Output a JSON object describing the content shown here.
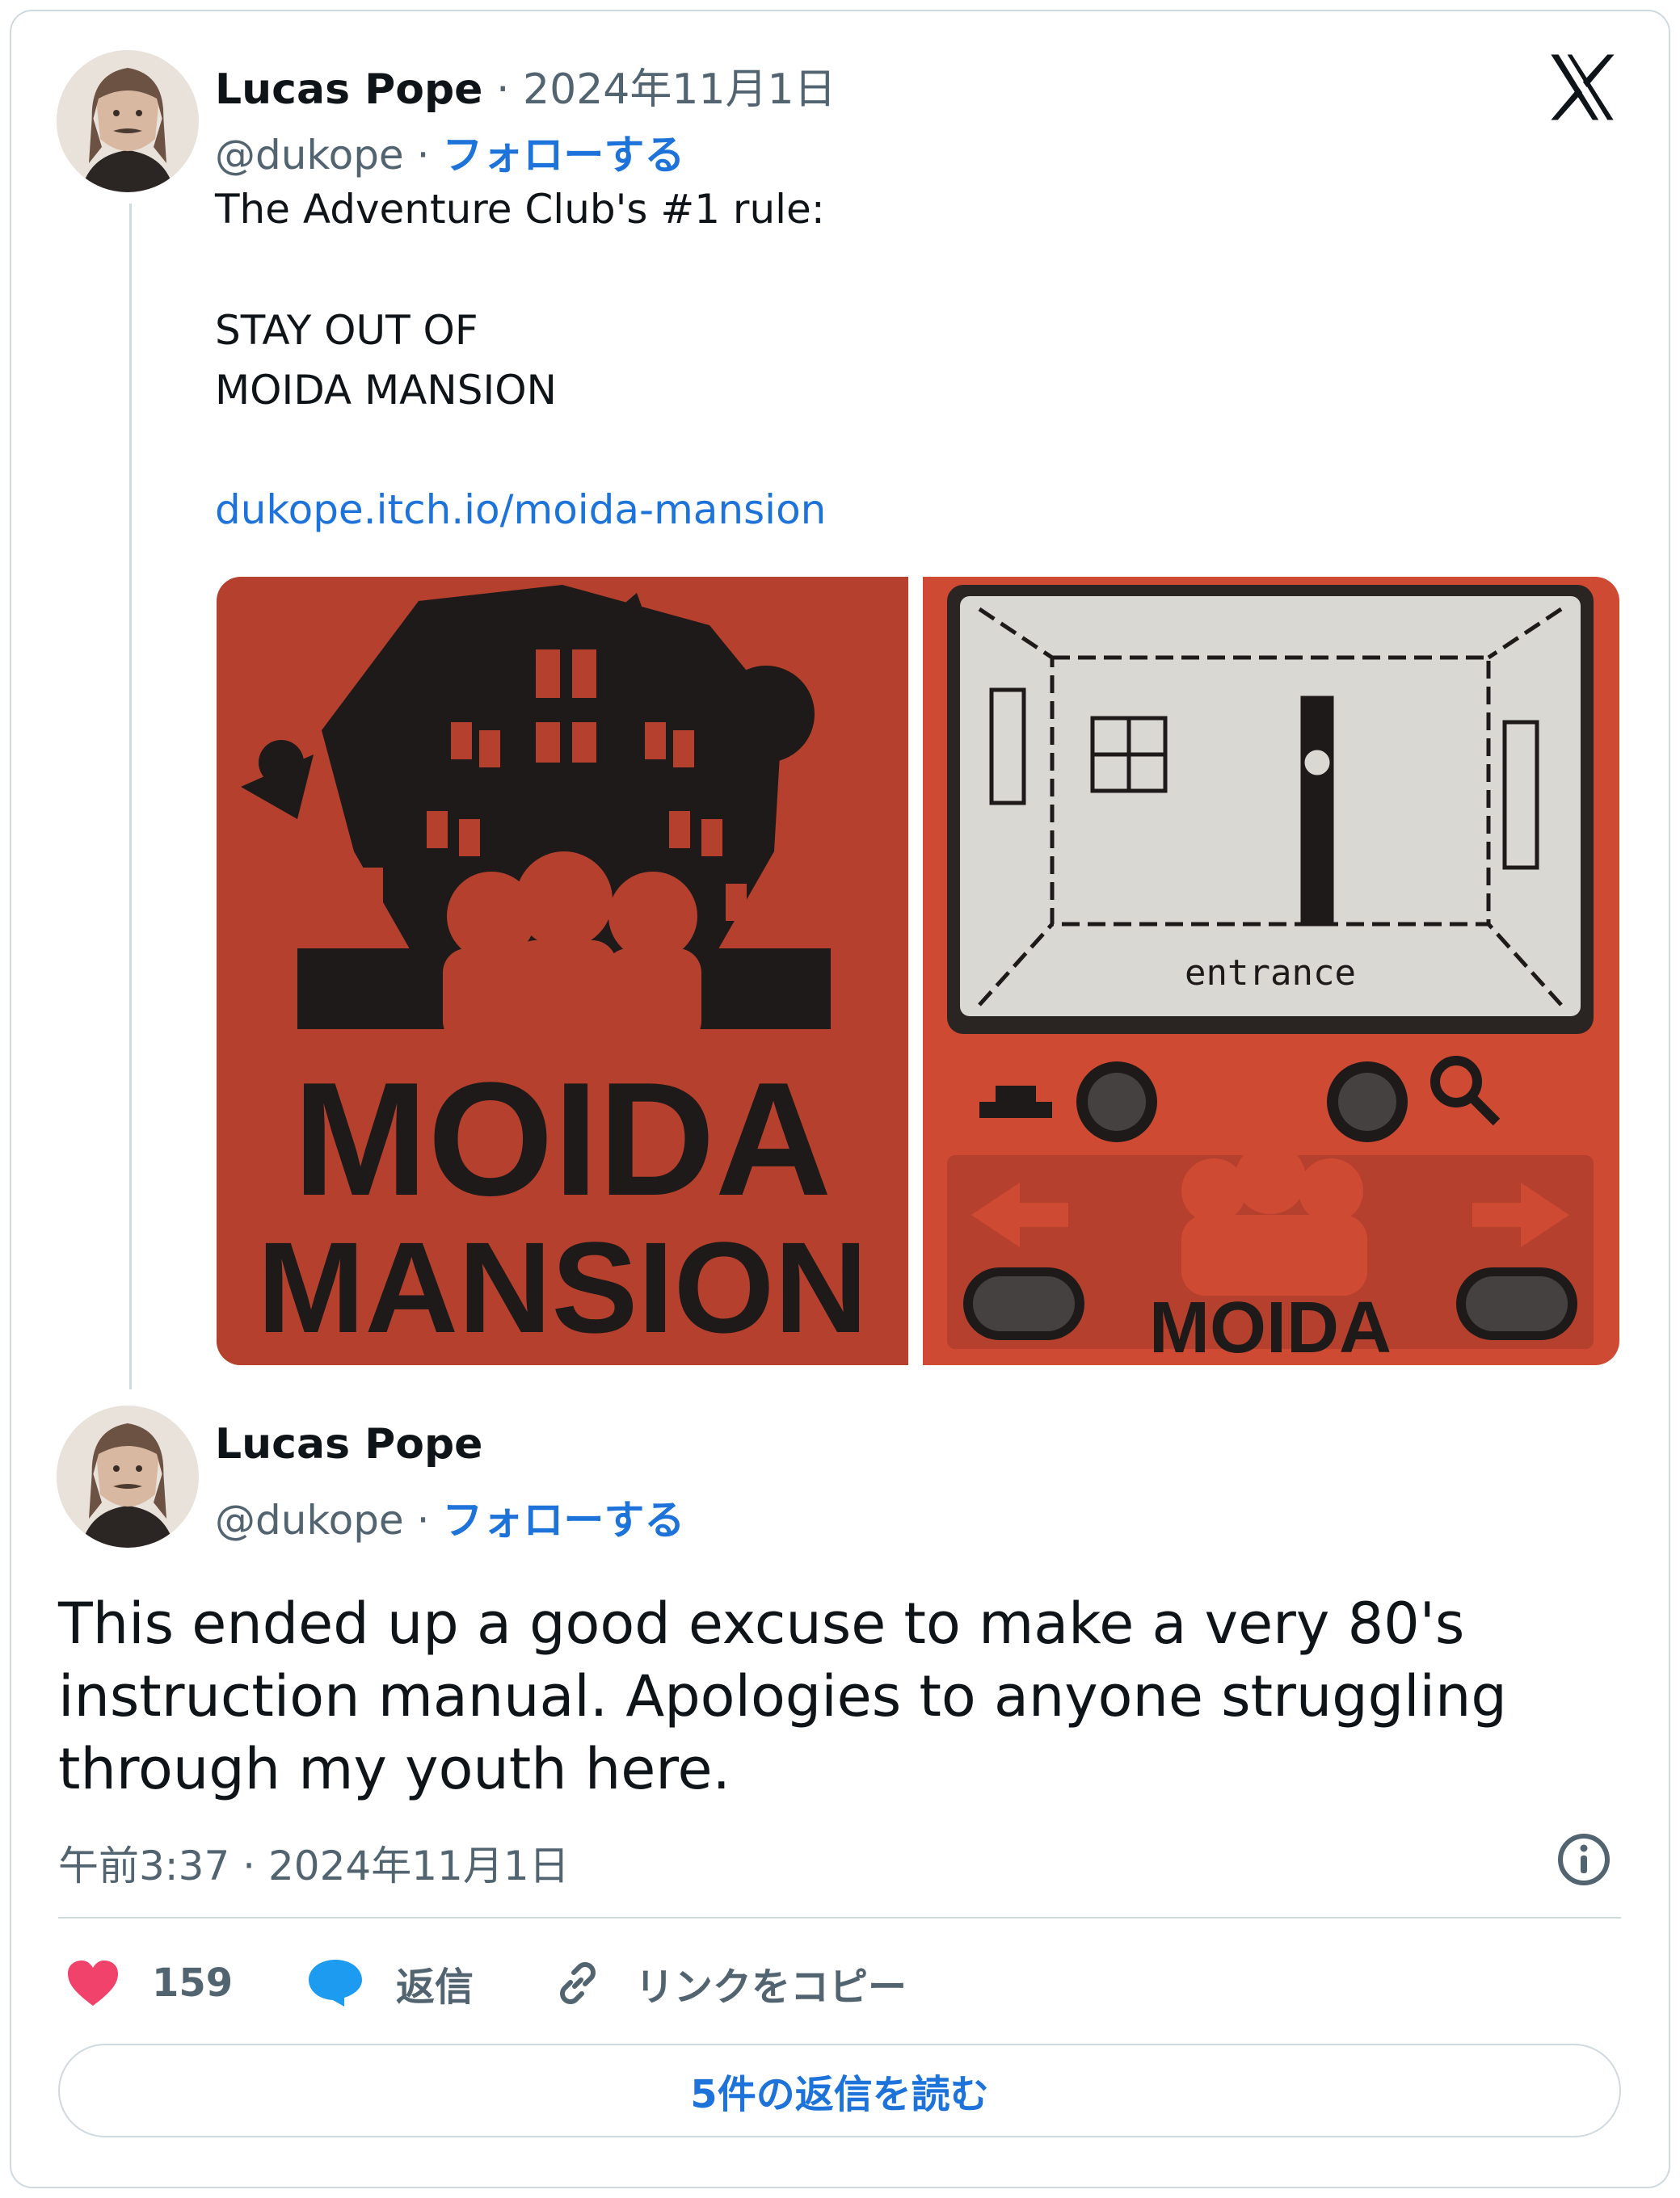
{
  "tweet1": {
    "author_name": "Lucas Pope",
    "date": "2024年11月1日",
    "handle": "@dukope",
    "follow_label": "フォローする",
    "text_lines": [
      "The Adventure Club's #1 rule:",
      "STAY OUT OF",
      "MOIDA MANSION"
    ],
    "link": "dukope.itch.io/moida-mansion"
  },
  "media": {
    "left_title_line1": "MOIDA",
    "left_title_line2": "MANSION",
    "screen_label": "entrance",
    "device_logo": "MOIDA",
    "colors": {
      "accent": "#b5402d",
      "ink": "#1e1a19",
      "lcd": "#d9d8d2"
    }
  },
  "tweet2": {
    "author_name": "Lucas Pope",
    "handle": "@dukope",
    "follow_label": "フォローする",
    "body": "This ended up a good excuse to make a very 80's instruction manual. Apologies to anyone struggling through my youth here.",
    "time": "午前3:37 · 2024年11月1日"
  },
  "actions": {
    "like_count": "159",
    "reply_label": "返信",
    "copy_link_label": "リンクをコピー",
    "read_replies_label": "5件の返信を読む"
  },
  "icons": [
    "x-logo-icon",
    "info-icon",
    "heart-icon",
    "reply-bubble-icon",
    "link-icon"
  ],
  "colors": {
    "link": "#1d73d9",
    "muted": "#536471",
    "heart": "#f0426b",
    "reply": "#1d9bf0",
    "border": "#cfd9de"
  }
}
